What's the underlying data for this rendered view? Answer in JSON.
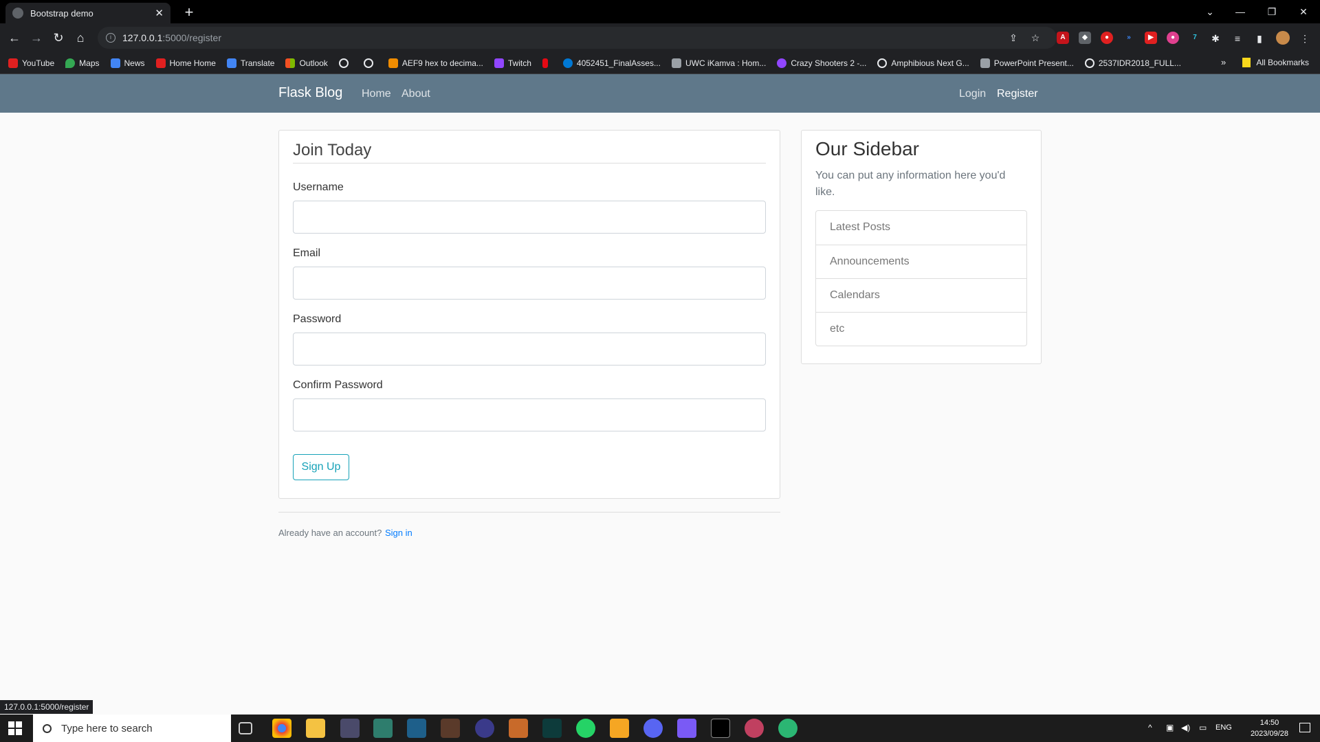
{
  "browser": {
    "tab_title": "Bootstrap demo",
    "url_host": "127.0.0.1",
    "url_path": ":5000/register",
    "bookmarks": [
      "YouTube",
      "Maps",
      "News",
      "Home Home",
      "Translate",
      "Outlook",
      "",
      "",
      "AEF9 hex to decima...",
      "Twitch",
      "",
      "4052451_FinalAsses...",
      "UWC iKamva : Hom...",
      "Crazy Shooters 2 -...",
      "Amphibious Next G...",
      "PowerPoint Present...",
      "2537IDR2018_FULL..."
    ],
    "all_bookmarks": "All Bookmarks",
    "more": "»",
    "status_url": "127.0.0.1:5000/register"
  },
  "navbar": {
    "brand": "Flask Blog",
    "home": "Home",
    "about": "About",
    "login": "Login",
    "register": "Register"
  },
  "form": {
    "legend": "Join Today",
    "username_label": "Username",
    "email_label": "Email",
    "password_label": "Password",
    "confirm_label": "Confirm Password",
    "submit": "Sign Up",
    "already": "Already have an account?",
    "signin": "Sign in"
  },
  "sidebar": {
    "title": "Our Sidebar",
    "text": "You can put any information here you'd like.",
    "items": [
      {
        "label": "Latest Posts"
      },
      {
        "label": "Announcements"
      },
      {
        "label": "Calendars"
      },
      {
        "label": "etc"
      }
    ]
  },
  "taskbar": {
    "search_placeholder": "Type here to search",
    "lang": "ENG",
    "time": "14:50",
    "date": "2023/09/28"
  }
}
